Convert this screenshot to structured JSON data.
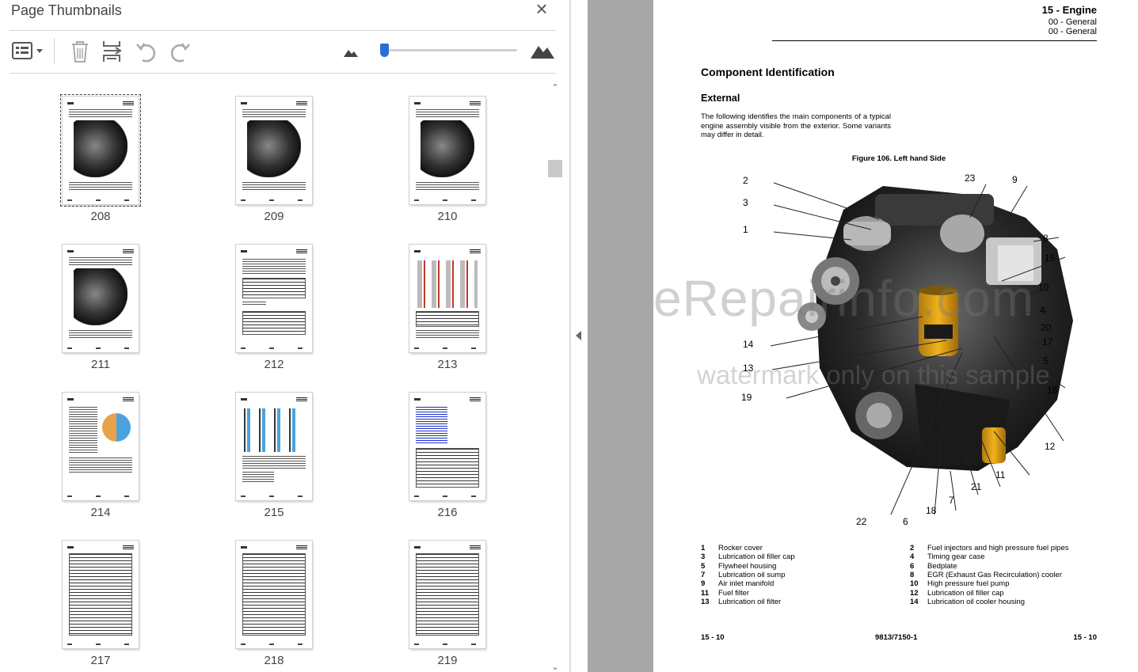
{
  "panel": {
    "title": "Page Thumbnails",
    "close_icon": "×",
    "toolbar": {
      "options_icon": "thumbnail-options-icon",
      "delete_icon": "trash-icon",
      "insert_icon": "insert-pages-icon",
      "rotate_ccw_icon": "rotate-counterclockwise-icon",
      "rotate_cw_icon": "rotate-clockwise-icon",
      "zoom_out_icon": "small-mountain-icon",
      "zoom_in_icon": "large-mountain-icon"
    },
    "zoom_level": 0.03,
    "accent_color": "#2a6fd6"
  },
  "thumbnails": [
    {
      "label": "208",
      "selected": true,
      "kind": "engine"
    },
    {
      "label": "209",
      "selected": false,
      "kind": "engine"
    },
    {
      "label": "210",
      "selected": false,
      "kind": "engine"
    },
    {
      "label": "211",
      "selected": false,
      "kind": "engine"
    },
    {
      "label": "212",
      "selected": false,
      "kind": "text"
    },
    {
      "label": "213",
      "selected": false,
      "kind": "injectors"
    },
    {
      "label": "214",
      "selected": false,
      "kind": "diagram"
    },
    {
      "label": "215",
      "selected": false,
      "kind": "pistons"
    },
    {
      "label": "216",
      "selected": false,
      "kind": "table-blue"
    },
    {
      "label": "217",
      "selected": false,
      "kind": "table"
    },
    {
      "label": "218",
      "selected": false,
      "kind": "table"
    },
    {
      "label": "219",
      "selected": false,
      "kind": "table"
    }
  ],
  "document": {
    "header": {
      "section": "15 - Engine",
      "sub1": "00 - General",
      "sub2": "00 - General"
    },
    "heading": "Component Identification",
    "subheading": "External",
    "intro": "The following identifies the main components of a typical engine assembly visible from the exterior. Some variants may differ in detail.",
    "figure_caption": "Figure 106. Left hand Side",
    "watermark_main": "eRepairinfo.com",
    "watermark_sub": "watermark only on this sample",
    "callouts": [
      "2",
      "3",
      "1",
      "14",
      "13",
      "19",
      "22",
      "6",
      "18",
      "7",
      "21",
      "11",
      "12",
      "16",
      "5",
      "17",
      "20",
      "4",
      "10",
      "15",
      "8",
      "9",
      "23"
    ],
    "legend": [
      {
        "n": "1",
        "t": "Rocker cover"
      },
      {
        "n": "2",
        "t": "Fuel injectors and high pressure fuel pipes"
      },
      {
        "n": "3",
        "t": "Lubrication oil filler cap"
      },
      {
        "n": "4",
        "t": "Timing gear case"
      },
      {
        "n": "5",
        "t": "Flywheel housing"
      },
      {
        "n": "6",
        "t": "Bedplate"
      },
      {
        "n": "7",
        "t": "Lubrication oil sump"
      },
      {
        "n": "8",
        "t": "EGR (Exhaust Gas Recirculation) cooler"
      },
      {
        "n": "9",
        "t": "Air inlet manifold"
      },
      {
        "n": "10",
        "t": "High pressure fuel pump"
      },
      {
        "n": "11",
        "t": "Fuel filter"
      },
      {
        "n": "12",
        "t": "Lubrication oil filler cap"
      },
      {
        "n": "13",
        "t": "Lubrication oil filter"
      },
      {
        "n": "14",
        "t": "Lubrication oil cooler housing"
      }
    ],
    "footer": {
      "left": "15 - 10",
      "center": "9813/7150-1",
      "right": "15 - 10"
    }
  }
}
